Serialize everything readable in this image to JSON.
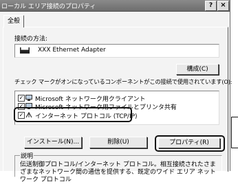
{
  "window": {
    "title": "ローカル エリア接続のプロパティ",
    "help_label": "?",
    "close_label": "×"
  },
  "tabs": [
    {
      "label": "全般"
    }
  ],
  "connect_using": {
    "label": "接続の方法:",
    "adapter": "XXX Ethernet Adapter",
    "adapter_icon_glyph": "▀▀"
  },
  "configure_button": "構成(C)",
  "components_label": "チェック マークがオンになっているコンポーネントがこの接続で使用されています(O):",
  "components": [
    {
      "label": "Microsoft ネットワーク用クライアント",
      "checked": true
    },
    {
      "label": "Microsoft ネットワーク用ファイルとプリンタ共有",
      "checked": true
    },
    {
      "label": "インターネット プロトコル (TCP/IP)",
      "checked": true
    }
  ],
  "buttons": {
    "install": "インストール(N)...",
    "uninstall": "削除(U)",
    "properties": "プロパティ(R)"
  },
  "description": {
    "label": "説明",
    "text": "伝送制御プロトコル/インターネット プロトコル。相互接続されたさまざまなネットワーク間の通信を提供する、既定のワイド エリア ネットワーク プロトコル"
  }
}
